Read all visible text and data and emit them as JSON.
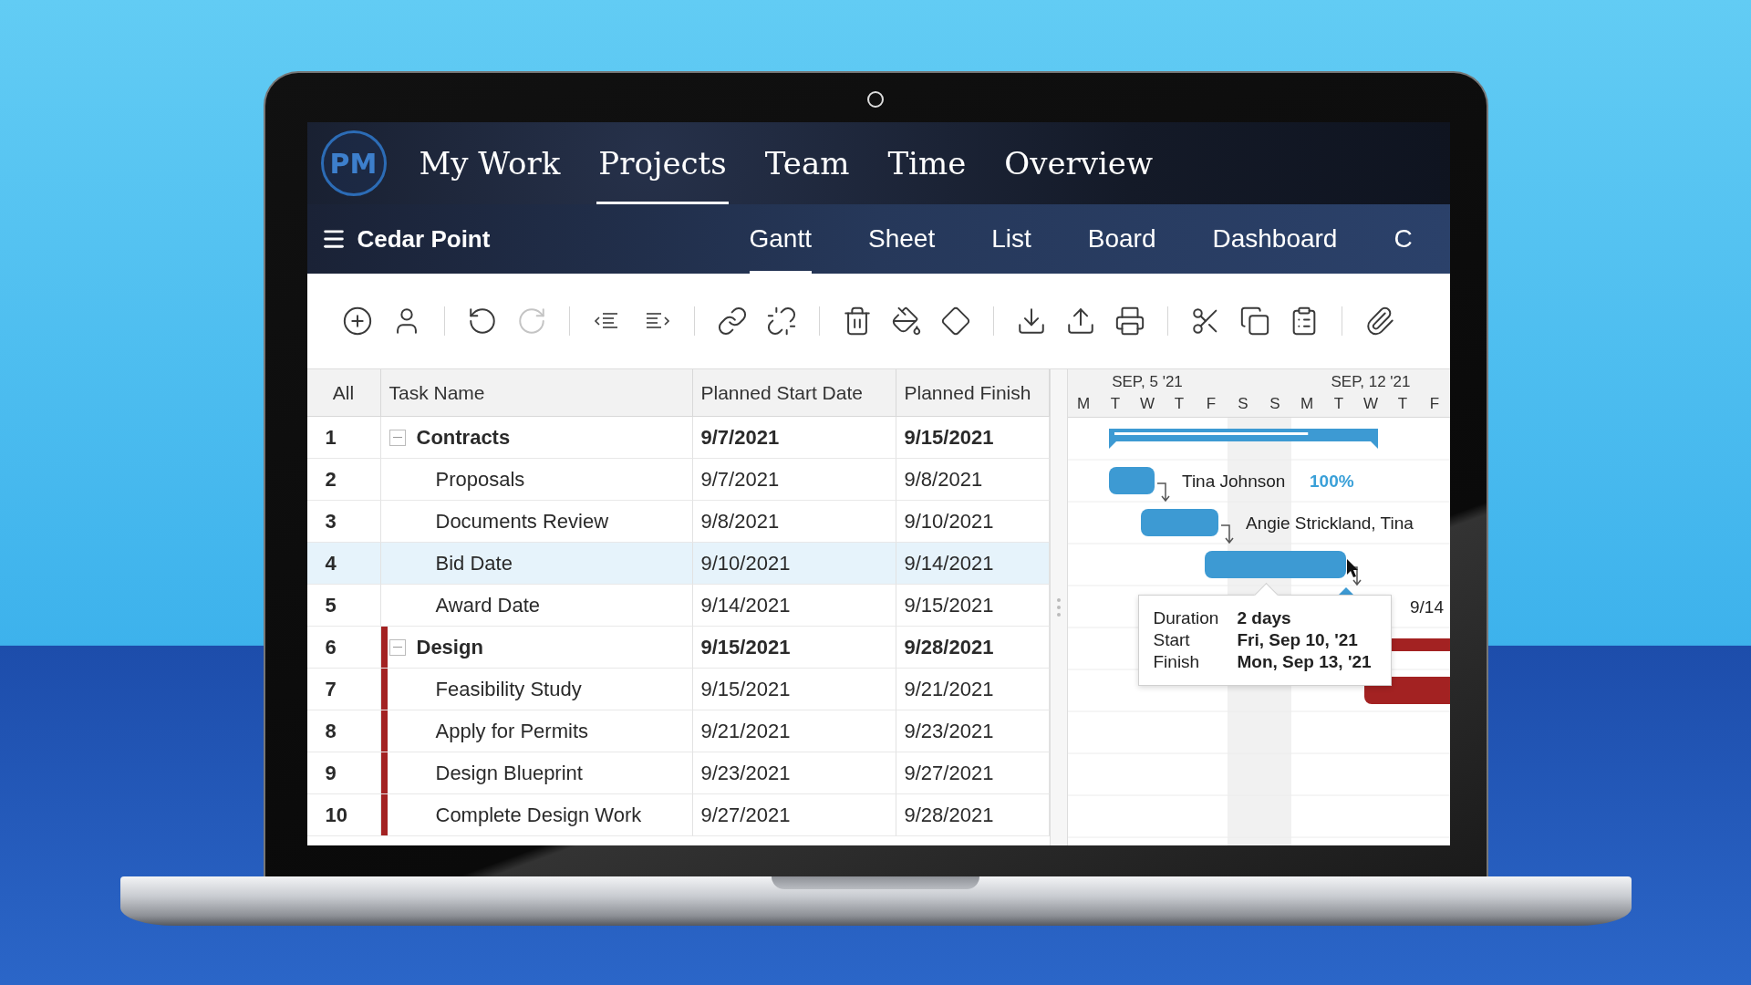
{
  "nav": {
    "logo": "PM",
    "items": [
      {
        "label": "My Work",
        "selected": false
      },
      {
        "label": "Projects",
        "selected": true
      },
      {
        "label": "Team",
        "selected": false
      },
      {
        "label": "Time",
        "selected": false
      },
      {
        "label": "Overview",
        "selected": false
      }
    ]
  },
  "project": {
    "title": "Cedar Point",
    "views": [
      {
        "label": "Gantt",
        "selected": true
      },
      {
        "label": "Sheet",
        "selected": false
      },
      {
        "label": "List",
        "selected": false
      },
      {
        "label": "Board",
        "selected": false
      },
      {
        "label": "Dashboard",
        "selected": false
      },
      {
        "label": "C",
        "selected": false
      }
    ]
  },
  "toolbar": [
    {
      "kind": "add",
      "disabled": false
    },
    {
      "kind": "user",
      "disabled": false
    },
    {
      "kind": "sep"
    },
    {
      "kind": "undo",
      "disabled": false
    },
    {
      "kind": "redo",
      "disabled": true
    },
    {
      "kind": "sep"
    },
    {
      "kind": "outdent",
      "disabled": false
    },
    {
      "kind": "indent",
      "disabled": false
    },
    {
      "kind": "sep"
    },
    {
      "kind": "link",
      "disabled": false
    },
    {
      "kind": "unlink",
      "disabled": false
    },
    {
      "kind": "sep"
    },
    {
      "kind": "delete",
      "disabled": false
    },
    {
      "kind": "fill",
      "disabled": false
    },
    {
      "kind": "milestone",
      "disabled": false
    },
    {
      "kind": "sep"
    },
    {
      "kind": "import",
      "disabled": false
    },
    {
      "kind": "export",
      "disabled": false
    },
    {
      "kind": "print",
      "disabled": false
    },
    {
      "kind": "sep"
    },
    {
      "kind": "cut",
      "disabled": false
    },
    {
      "kind": "copy",
      "disabled": false
    },
    {
      "kind": "paste",
      "disabled": false
    },
    {
      "kind": "sep"
    },
    {
      "kind": "attach",
      "disabled": false
    }
  ],
  "table": {
    "columns": [
      "All",
      "Task Name",
      "Planned Start Date",
      "Planned Finish"
    ],
    "rows": [
      {
        "num": "1",
        "name": "Contracts",
        "start": "9/7/2021",
        "finish": "9/15/2021",
        "kind": "group",
        "expanded": true,
        "selected": false,
        "level": 0.75
      },
      {
        "num": "2",
        "name": "Proposals",
        "start": "9/7/2021",
        "finish": "9/8/2021",
        "kind": "task",
        "selected": false,
        "link_to_next": true,
        "gantt_label": "Tina Johnson",
        "gantt_percent": "100%"
      },
      {
        "num": "3",
        "name": "Documents Review",
        "start": "9/8/2021",
        "finish": "9/10/2021",
        "kind": "task",
        "selected": false,
        "link_to_next": true,
        "gantt_label": "Angie Strickland, Tina"
      },
      {
        "num": "4",
        "name": "Bid Date",
        "start": "9/10/2021",
        "finish": "9/14/2021",
        "kind": "task",
        "selected": true,
        "link_to_next": true
      },
      {
        "num": "5",
        "name": "Award Date",
        "start": "9/14/2021",
        "finish": "9/15/2021",
        "kind": "milestone",
        "selected": false,
        "gantt_label": "9/14"
      },
      {
        "num": "6",
        "name": "Design",
        "start": "9/15/2021",
        "finish": "9/28/2021",
        "kind": "group",
        "expanded": true,
        "selected": false,
        "color": "#a32222"
      },
      {
        "num": "7",
        "name": "Feasibility Study",
        "start": "9/15/2021",
        "finish": "9/21/2021",
        "kind": "task",
        "selected": false,
        "color": "#a32222"
      },
      {
        "num": "8",
        "name": "Apply for Permits",
        "start": "9/21/2021",
        "finish": "9/23/2021",
        "kind": "task",
        "selected": false,
        "color": "#a32222"
      },
      {
        "num": "9",
        "name": "Design Blueprint",
        "start": "9/23/2021",
        "finish": "9/27/2021",
        "kind": "task",
        "selected": false,
        "color": "#a32222"
      },
      {
        "num": "10",
        "name": "Complete Design Work",
        "start": "9/27/2021",
        "finish": "9/28/2021",
        "kind": "task",
        "selected": false,
        "color": "#a32222"
      }
    ]
  },
  "gantt": {
    "weeks": [
      "SEP, 5 '21",
      "SEP, 12 '21"
    ],
    "days": [
      {
        "label": "M",
        "weekend": false
      },
      {
        "label": "T",
        "weekend": false
      },
      {
        "label": "W",
        "weekend": false
      },
      {
        "label": "T",
        "weekend": false
      },
      {
        "label": "F",
        "weekend": false
      },
      {
        "label": "S",
        "weekend": true
      },
      {
        "label": "S",
        "weekend": true
      },
      {
        "label": "M",
        "weekend": false
      },
      {
        "label": "T",
        "weekend": false
      },
      {
        "label": "W",
        "weekend": false
      },
      {
        "label": "T",
        "weekend": false
      },
      {
        "label": "F",
        "weekend": false
      }
    ],
    "tooltip": [
      {
        "label": "Duration",
        "value": "2 days"
      },
      {
        "label": "Start",
        "value": "Fri, Sep 10, '21"
      },
      {
        "label": "Finish",
        "value": "Mon, Sep 13, '21"
      }
    ]
  }
}
